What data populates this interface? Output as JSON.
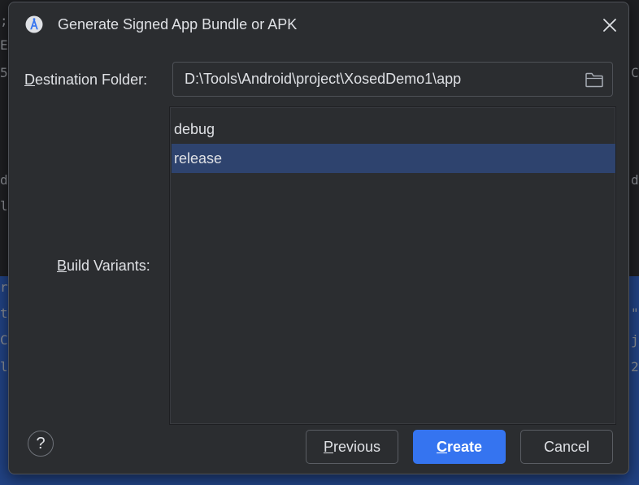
{
  "dialog": {
    "title": "Generate Signed App Bundle or APK"
  },
  "destination": {
    "label_mnemonic": "D",
    "label_rest": "estination Folder:",
    "value": "D:\\Tools\\Android\\project\\XosedDemo1\\app"
  },
  "build_variants": {
    "label_mnemonic": "B",
    "label_rest": "uild Variants:",
    "items": [
      {
        "label": "debug",
        "selected": false
      },
      {
        "label": "release",
        "selected": true
      }
    ]
  },
  "buttons": {
    "help_label": "?",
    "previous_mnemonic": "P",
    "previous_rest": "revious",
    "create_mnemonic": "C",
    "create_rest": "reate",
    "cancel_label": "Cancel"
  },
  "background_fragments": {
    "left": [
      ";",
      "E",
      "5",
      "d",
      "l",
      "r",
      "t",
      "C",
      "l"
    ],
    "right": [
      "C",
      "d",
      "\"",
      "j",
      "2"
    ]
  },
  "icons": {
    "app": "android-studio-icon",
    "close": "close-icon",
    "folder": "folder-icon"
  },
  "colors": {
    "dialog_bg": "#2b2d30",
    "selection": "#2e436e",
    "primary_button": "#3574f0",
    "text": "#dfe1e5"
  }
}
